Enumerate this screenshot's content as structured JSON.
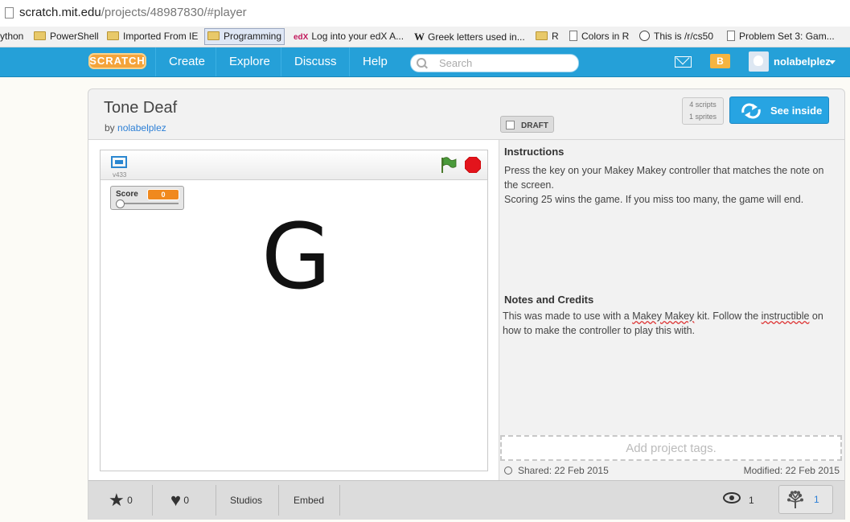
{
  "browser": {
    "url_host": "scratch.mit.edu",
    "url_path": "/projects/48987830/#player",
    "bookmarks": [
      {
        "label": "ython",
        "icon": "none"
      },
      {
        "label": "PowerShell",
        "icon": "folder"
      },
      {
        "label": "Imported From IE",
        "icon": "folder"
      },
      {
        "label": "Programming",
        "icon": "folder",
        "active": true
      },
      {
        "label": "Log into your edX A...",
        "icon": "edx"
      },
      {
        "label": "Greek letters used in...",
        "icon": "wiki"
      },
      {
        "label": "R",
        "icon": "folder"
      },
      {
        "label": "Colors in R",
        "icon": "doc"
      },
      {
        "label": "This is /r/cs50",
        "icon": "reddit"
      },
      {
        "label": "Problem Set 3: Gam...",
        "icon": "doc"
      }
    ]
  },
  "nav": {
    "logo": "SCRATCH",
    "links": [
      "Create",
      "Explore",
      "Discuss",
      "Help"
    ],
    "search_placeholder": "Search",
    "folder_badge": "B",
    "username": "nolabelplez",
    "color": "#25a0d8"
  },
  "project": {
    "title": "Tone Deaf",
    "by_prefix": "by",
    "author": "nolabelplez",
    "draft_label": "DRAFT",
    "scripts_count": "4 scripts",
    "sprites_count": "1 sprites",
    "see_inside_label": "See inside",
    "player": {
      "version": "v433",
      "score_label": "Score",
      "score_value": "0",
      "stage_letter": "G"
    },
    "instructions_heading": "Instructions",
    "instructions_line1": "Press the key on your Makey Makey controller that matches the note on the screen.",
    "instructions_line2": "Scoring 25 wins the game. If you miss too many, the game will end.",
    "notes_heading": "Notes and Credits",
    "notes_part1": "This was made to use with a ",
    "notes_link1": "Makey Makey",
    "notes_part2": " kit. Follow the ",
    "notes_link2": "instructible",
    "notes_part3": " on how to make the controller to play this with.",
    "tags_placeholder": "Add project tags.",
    "shared": "Shared: 22 Feb 2015",
    "modified": "Modified: 22 Feb 2015"
  },
  "stats": {
    "favorites": "0",
    "loves": "0",
    "studios_label": "Studios",
    "embed_label": "Embed",
    "views": "1",
    "remixes": "1"
  }
}
